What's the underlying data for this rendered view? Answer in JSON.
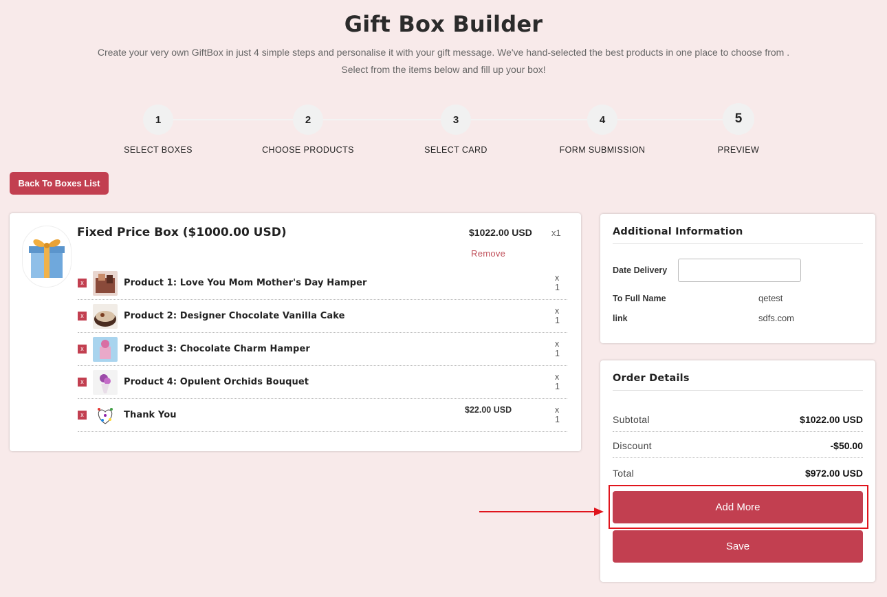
{
  "header": {
    "title": "Gift Box Builder",
    "intro": "Create your very own GiftBox in just 4 simple steps and personalise it with your gift message. We've hand-selected the best products in one place to choose from . Select from the items below and fill up your box!"
  },
  "steps": [
    {
      "number": "1",
      "label": "SELECT BOXES"
    },
    {
      "number": "2",
      "label": "CHOOSE PRODUCTS"
    },
    {
      "number": "3",
      "label": "SELECT CARD"
    },
    {
      "number": "4",
      "label": "FORM SUBMISSION"
    },
    {
      "number": "5",
      "label": "PREVIEW"
    }
  ],
  "back_button": "Back To Boxes List",
  "box": {
    "title": "Fixed Price Box ($1000.00 USD)",
    "price": "$1022.00 USD",
    "qty": "x1",
    "remove": "Remove",
    "items": [
      {
        "del": "x",
        "name": "Product 1: Love You Mom Mother's Day Hamper",
        "price": "",
        "qty": "x 1"
      },
      {
        "del": "x",
        "name": "Product 2: Designer Chocolate Vanilla Cake",
        "price": "",
        "qty": "x 1"
      },
      {
        "del": "x",
        "name": "Product 3: Chocolate Charm Hamper",
        "price": "",
        "qty": "x 1"
      },
      {
        "del": "x",
        "name": "Product 4: Opulent Orchids Bouquet",
        "price": "",
        "qty": "x 1"
      },
      {
        "del": "x",
        "name": "Thank You",
        "price": "$22.00 USD",
        "qty": "x 1"
      }
    ]
  },
  "additional_info": {
    "heading": "Additional Information",
    "date_label": "Date Delivery",
    "date_value": "",
    "name_label": "To Full Name",
    "name_value": "qetest",
    "link_label": "link",
    "link_value": "sdfs.com"
  },
  "order": {
    "heading": "Order Details",
    "subtotal_label": "Subtotal",
    "subtotal_value": "$1022.00 USD",
    "discount_label": "Discount",
    "discount_value": "-$50.00",
    "total_label": "Total",
    "total_value": "$972.00 USD",
    "add_more": "Add More",
    "save": "Save"
  },
  "colors": {
    "background": "#f8eaea",
    "accent": "#c23f50",
    "annotation": "#e0141c"
  },
  "icons": [
    "gift-box-icon",
    "close-icon",
    "arrow-right-icon"
  ]
}
